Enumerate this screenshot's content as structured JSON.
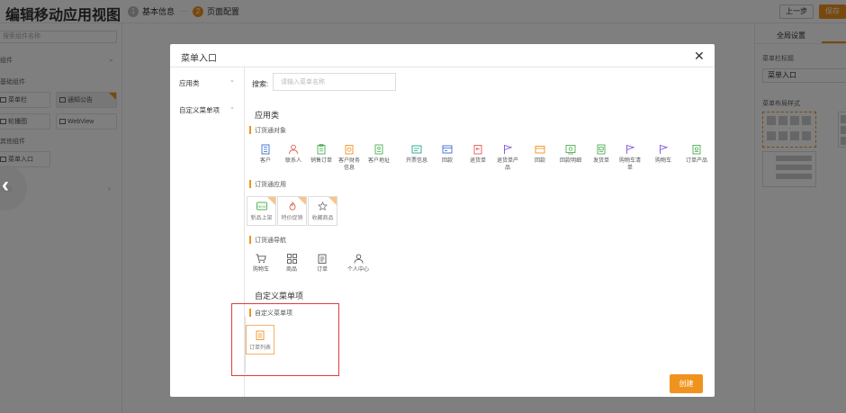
{
  "app": {
    "title": "编辑移动应用视图",
    "steps": [
      {
        "num": "1",
        "label": "基本信息"
      },
      {
        "num": "2",
        "label": "页面配置"
      }
    ],
    "prev_label": "上一步",
    "save_label": "保存"
  },
  "left_panel": {
    "search_placeholder": "搜索组件名称",
    "sections": [
      "组件",
      "基础组件",
      "其他组件",
      "布局"
    ],
    "items": [
      "菜单栏",
      "通知公告",
      "轮播图",
      "WebView",
      "菜单入口"
    ]
  },
  "right_panel": {
    "tab": "全局设置",
    "name_label": "菜单栏标题",
    "name_value": "菜单入口",
    "layout_label": "菜单布局样式"
  },
  "modal": {
    "title": "菜单入口",
    "close_icon": "✕",
    "sidebar": [
      "应用类",
      "自定义菜单项"
    ],
    "search_label": "搜索:",
    "search_placeholder": "请输入菜单名称",
    "app_section": "应用类",
    "groups": {
      "objects": {
        "title": "订货通对象",
        "items": [
          {
            "label": "客户",
            "icon": "building-icon"
          },
          {
            "label": "联系人",
            "icon": "person-icon"
          },
          {
            "label": "销售订单",
            "icon": "clipboard-icon"
          },
          {
            "label": "客户财务信息",
            "icon": "finance-icon"
          },
          {
            "label": "客户地址",
            "icon": "address-book-icon"
          },
          {
            "label": "开票信息",
            "icon": "invoice-icon"
          },
          {
            "label": "回款",
            "icon": "payment-icon"
          },
          {
            "label": "退货单",
            "icon": "return-icon"
          },
          {
            "label": "退货单产品",
            "icon": "flag-icon"
          },
          {
            "label": "回款",
            "icon": "wallet-icon"
          },
          {
            "label": "回款明细",
            "icon": "detail-icon"
          },
          {
            "label": "发货单",
            "icon": "shipping-icon"
          },
          {
            "label": "购物车清单",
            "icon": "flag-icon"
          },
          {
            "label": "购物车",
            "icon": "flag-icon"
          },
          {
            "label": "订单产品",
            "icon": "product-icon"
          }
        ]
      },
      "apps": {
        "title": "订货通应用",
        "items": [
          {
            "label": "新品上架",
            "icon": "new-badge-icon"
          },
          {
            "label": "特价促销",
            "icon": "flame-icon"
          },
          {
            "label": "收藏商品",
            "icon": "star-icon"
          }
        ]
      },
      "nav": {
        "title": "订货通导航",
        "items": [
          {
            "label": "购物车",
            "icon": "cart-icon"
          },
          {
            "label": "商品",
            "icon": "grid-icon"
          },
          {
            "label": "订单",
            "icon": "order-icon"
          },
          {
            "label": "个人中心",
            "icon": "user-icon"
          }
        ]
      }
    },
    "custom_section": "自定义菜单项",
    "custom_group_title": "自定义菜单项",
    "custom_items": [
      {
        "label": "订单列表",
        "icon": "list-icon"
      }
    ],
    "create_label": "创建"
  },
  "colors": {
    "accent": "#f0931e",
    "highlight": "#e03a3a",
    "icon_blue": "#3b6ad6",
    "icon_orange": "#f0931e",
    "icon_green": "#4caf50",
    "icon_teal": "#1fa58f",
    "icon_purple": "#7b52d6",
    "icon_red": "#e05a4f"
  }
}
